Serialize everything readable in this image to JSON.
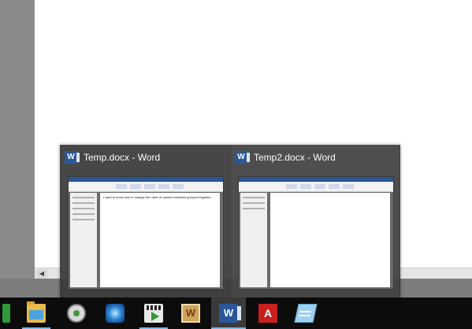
{
  "thumbnails": [
    {
      "title": "Temp.docx - Word",
      "icon": "word-icon",
      "preview_text": "I want to know how to change the order of opened windows grouped together."
    },
    {
      "title": "Temp2.docx - Word",
      "icon": "word-icon",
      "preview_text": ""
    }
  ],
  "taskbar": {
    "items": [
      {
        "name": "green-app-icon",
        "running": false
      },
      {
        "name": "file-explorer-icon",
        "running": true
      },
      {
        "name": "sync-app-icon",
        "running": false
      },
      {
        "name": "blue-orb-app-icon",
        "running": false
      },
      {
        "name": "media-player-icon",
        "running": true
      },
      {
        "name": "wordament-tile-icon",
        "running": false
      },
      {
        "name": "word-icon",
        "running": true,
        "active": true
      },
      {
        "name": "acrobat-pdf-icon",
        "running": false
      },
      {
        "name": "notepad-icon",
        "running": false
      }
    ],
    "word_glyph": "W",
    "tile_glyph": "W",
    "pdf_glyph": "A"
  },
  "colors": {
    "accent": "#76b9ed",
    "word_blue": "#2b579a",
    "taskbar_bg": "#0c0c0c",
    "popup_bg": "#3c3c3c"
  }
}
